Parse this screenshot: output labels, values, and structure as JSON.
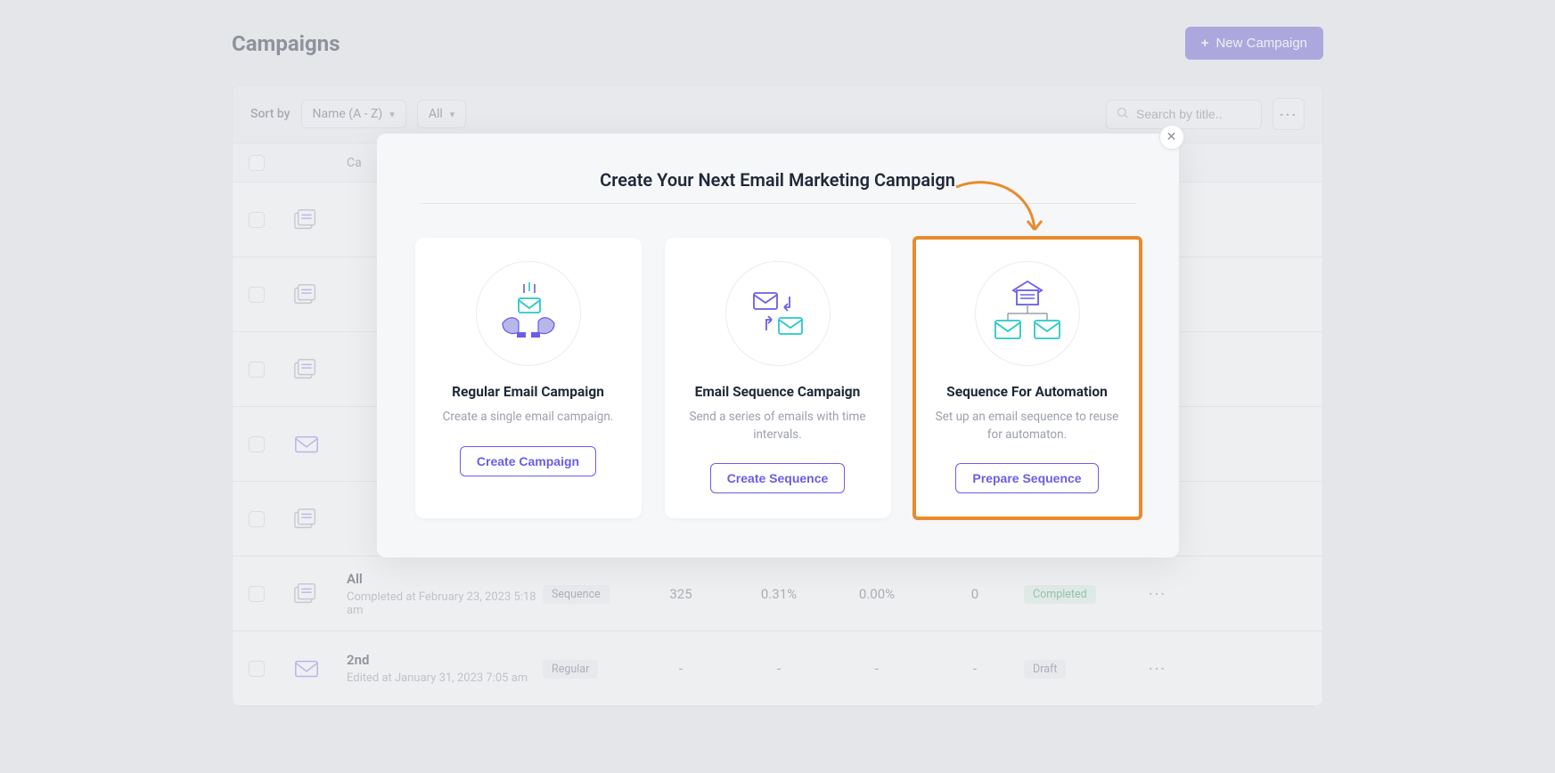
{
  "page_title": "Campaigns",
  "new_campaign_button": "New Campaign",
  "sort": {
    "label": "Sort by",
    "value": "Name (A - Z)",
    "filter": "All"
  },
  "search_placeholder": "Search by title..",
  "table_header_campaign": "Ca",
  "rows": {
    "visiblePartial": true,
    "all": {
      "title": "All",
      "subtitle": "Completed at February 23, 2023 5:18 am",
      "tag": "Sequence",
      "c1": "325",
      "c2": "0.31%",
      "c3": "0.00%",
      "c4": "0",
      "status": "Completed"
    },
    "second": {
      "title": "2nd",
      "subtitle": "Edited at January 31, 2023 7:05 am",
      "tag": "Regular",
      "c1": "-",
      "c2": "-",
      "c3": "-",
      "c4": "-",
      "status": "Draft"
    }
  },
  "modal": {
    "title": "Create Your Next Email Marketing Campaign",
    "card1_title": "Regular Email Campaign",
    "card1_desc": "Create a single email campaign.",
    "card1_button": "Create Campaign",
    "card2_title": "Email Sequence Campaign",
    "card2_desc": "Send a series of emails with time intervals.",
    "card2_button": "Create Sequence",
    "card3_title": "Sequence For Automation",
    "card3_desc": "Set up an email sequence to reuse for automaton.",
    "card3_button": "Prepare Sequence"
  }
}
